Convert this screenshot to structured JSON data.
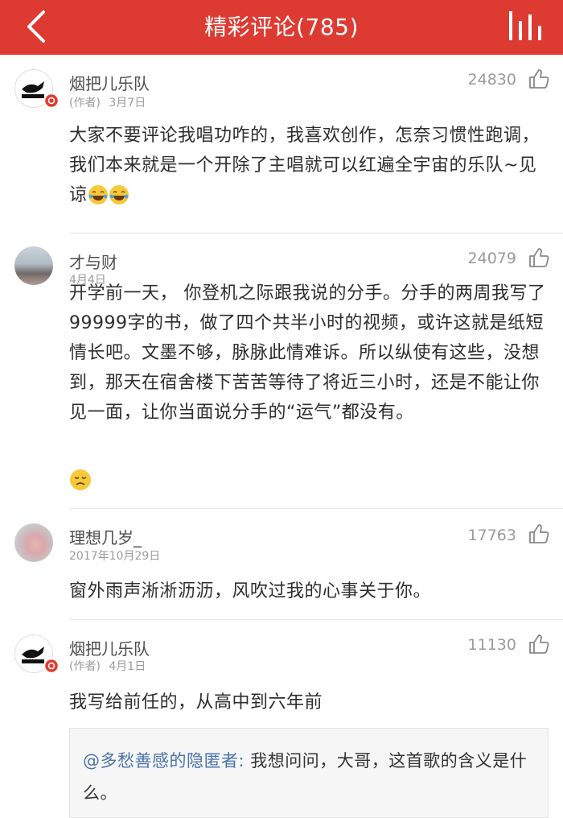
{
  "header": {
    "title": "精彩评论(785)",
    "back_icon": "chevron-left-icon",
    "menu_icon": "bars-icon",
    "color": "#dd3b32"
  },
  "comments": [
    {
      "author": "烟把儿乐队",
      "role": "(作者)",
      "date": "3月7日",
      "likes": "24830",
      "text": "大家不要评论我唱功咋的，我喜欢创作，怎奈习惯性跑调，我们本来就是一个开除了主唱就可以红遍全宇宙的乐队~见谅",
      "emojis": [
        "tears-of-joy-emoji",
        "tears-of-joy-emoji"
      ]
    },
    {
      "author": "才与财",
      "date": "4月4日",
      "likes": "24079",
      "text": "开学前一天， 你登机之际跟我说的分手。分手的两周我写了99999字的书，做了四个共半小时的视频，或许这就是纸短情长吧。文墨不够，脉脉此情难诉。所以纵使有这些，没想到，那天在宿舍楼下苦苦等待了将近三小时，还是不能让你见一面，让你当面说分手的“运气”都没有。",
      "emojis": [
        "disappointed-face-emoji"
      ]
    },
    {
      "author": "理想几岁_",
      "date": "2017年10月29日",
      "likes": "17763",
      "text": "窗外雨声淅淅沥沥，风吹过我的心事关于你。"
    },
    {
      "author": "烟把儿乐队",
      "role": "(作者)",
      "date": "4月1日",
      "likes": "11130",
      "text": "我写给前任的，从高中到六年前",
      "reply": {
        "mention": "@多愁善感的隐匿者:",
        "text": " 我想问问，大哥，这首歌的含义是什么。"
      }
    }
  ]
}
